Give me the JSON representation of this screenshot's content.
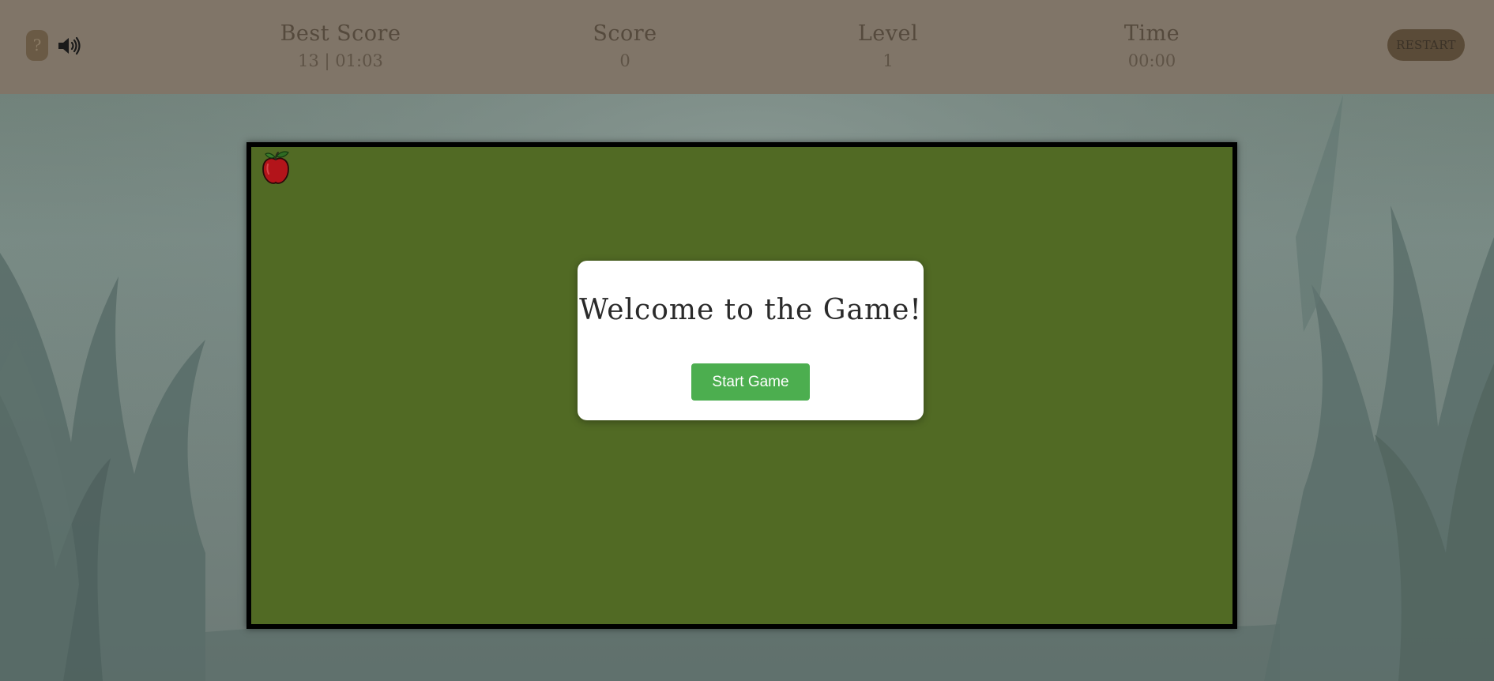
{
  "header": {
    "help_label": "?",
    "sound_icon": "speaker-volume-icon",
    "stats": {
      "best_score": {
        "label": "Best Score",
        "value": "13 | 01:03"
      },
      "score": {
        "label": "Score",
        "value": "0"
      },
      "level": {
        "label": "Level",
        "value": "1"
      },
      "time": {
        "label": "Time",
        "value": "00:00"
      }
    },
    "restart_label": "RESTART"
  },
  "board": {
    "item_icon": "apple-icon",
    "modal": {
      "title": "Welcome to the Game!",
      "start_label": "Start Game"
    }
  },
  "colors": {
    "header_bg": "#807568",
    "board_bg": "#516a24",
    "board_border": "#000000",
    "start_button": "#4cae4f",
    "apple": "#b3141a"
  }
}
